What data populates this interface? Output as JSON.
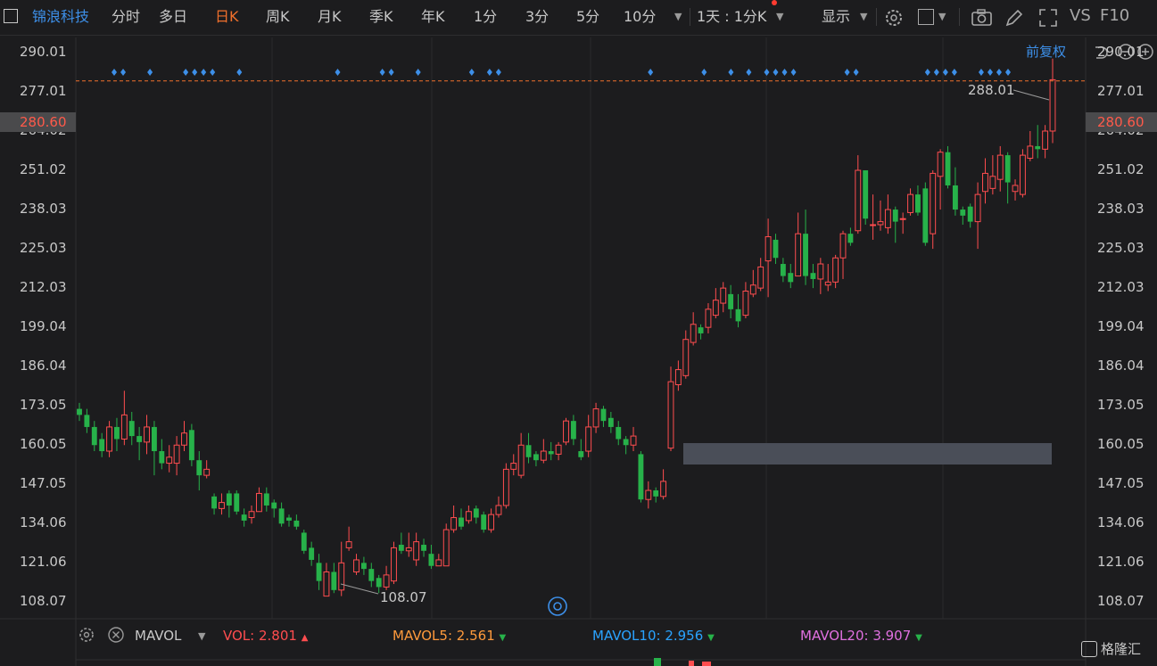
{
  "toolbar": {
    "stock_name": "锦浪科技",
    "periods": [
      "分时",
      "多日",
      "日K",
      "周K",
      "月K",
      "季K",
      "年K",
      "1分",
      "3分",
      "5分",
      "10分"
    ],
    "active_period": "日K",
    "range_label": "1天 : 1分K",
    "display_label": "显示",
    "vs_label": "VS",
    "f10_label": "F10"
  },
  "restore_label": "前复权",
  "price_current": "280.60",
  "high_label": "288.01",
  "low_label": "108.07",
  "chart_data": {
    "type": "candlestick",
    "y_ticks": [
      "290.01",
      "277.01",
      "264.02",
      "251.02",
      "238.03",
      "225.03",
      "212.03",
      "199.04",
      "186.04",
      "173.05",
      "160.05",
      "147.05",
      "134.06",
      "121.06",
      "108.07"
    ],
    "ylim": [
      102.5,
      295
    ],
    "current_price": 280.6,
    "high": 288.01,
    "low": 108.07,
    "candles": [
      [
        172,
        170,
        174,
        168
      ],
      [
        170,
        166,
        172,
        164
      ],
      [
        166,
        160,
        168,
        158
      ],
      [
        162,
        158,
        164,
        156
      ],
      [
        158,
        166,
        168,
        156
      ],
      [
        166,
        162,
        169,
        158
      ],
      [
        162,
        170,
        178,
        160
      ],
      [
        168,
        163,
        171,
        160
      ],
      [
        163,
        161,
        166,
        155
      ],
      [
        161,
        166,
        170,
        157
      ],
      [
        166,
        158,
        168,
        150
      ],
      [
        158,
        154,
        162,
        152
      ],
      [
        154,
        156,
        160,
        151
      ],
      [
        154,
        160,
        163,
        150
      ],
      [
        160,
        164,
        168,
        158
      ],
      [
        165,
        155,
        167,
        153
      ],
      [
        155,
        150,
        158,
        145
      ],
      [
        150,
        152,
        155,
        149
      ],
      [
        143,
        139,
        144,
        137
      ],
      [
        139,
        141,
        144,
        137
      ],
      [
        144,
        140,
        145,
        136
      ],
      [
        144,
        138,
        145,
        137
      ],
      [
        137,
        135,
        139,
        133
      ],
      [
        136,
        138,
        140,
        134
      ],
      [
        138,
        144,
        146,
        138
      ],
      [
        144,
        140,
        146,
        138
      ],
      [
        141,
        139,
        142,
        136
      ],
      [
        139,
        134,
        141,
        133
      ],
      [
        136,
        135,
        137,
        133
      ],
      [
        135,
        133,
        137,
        132
      ],
      [
        131,
        125,
        132,
        124
      ],
      [
        126,
        122,
        128,
        120
      ],
      [
        121,
        115,
        124,
        112
      ],
      [
        110,
        118,
        121,
        110
      ],
      [
        118,
        112,
        121,
        111
      ],
      [
        112,
        121,
        128,
        110
      ],
      [
        126,
        128,
        133,
        125
      ],
      [
        118,
        122,
        124,
        117
      ],
      [
        121,
        119,
        123,
        117
      ],
      [
        119,
        115,
        121,
        113
      ],
      [
        116,
        113,
        117,
        111
      ],
      [
        113,
        117,
        120,
        112
      ],
      [
        115,
        126,
        128,
        114
      ],
      [
        127,
        125,
        131,
        124
      ],
      [
        125,
        126,
        131,
        123
      ],
      [
        122,
        128,
        131,
        120
      ],
      [
        127,
        125,
        129,
        123
      ],
      [
        124,
        120,
        127,
        119
      ],
      [
        120,
        122,
        124,
        120
      ],
      [
        120,
        132,
        134,
        120
      ],
      [
        132,
        136,
        140,
        131
      ],
      [
        136,
        133,
        139,
        132
      ],
      [
        135,
        138,
        140,
        134
      ],
      [
        139,
        136,
        140,
        134
      ],
      [
        137,
        132,
        138,
        131
      ],
      [
        132,
        137,
        139,
        131
      ],
      [
        137,
        140,
        143,
        136
      ],
      [
        140,
        152,
        154,
        139
      ],
      [
        152,
        154,
        157,
        150
      ],
      [
        150,
        160,
        164,
        149
      ],
      [
        160,
        156,
        164,
        154
      ],
      [
        157,
        155,
        158,
        153
      ],
      [
        155,
        158,
        162,
        154
      ],
      [
        158,
        157,
        161,
        155
      ],
      [
        157,
        160,
        161,
        155
      ],
      [
        161,
        168,
        169,
        160
      ],
      [
        168,
        162,
        170,
        160
      ],
      [
        158,
        156,
        162,
        155
      ],
      [
        158,
        166,
        170,
        156
      ],
      [
        166,
        172,
        174,
        164
      ],
      [
        172,
        168,
        173,
        166
      ],
      [
        169,
        166,
        171,
        164
      ],
      [
        166,
        162,
        168,
        160
      ],
      [
        162,
        160,
        163,
        157
      ],
      [
        160,
        163,
        166,
        158
      ],
      [
        157,
        142,
        158,
        141
      ],
      [
        142,
        145,
        148,
        139
      ],
      [
        145,
        143,
        146,
        141
      ],
      [
        143,
        148,
        152,
        142
      ],
      [
        159,
        181,
        186,
        158
      ],
      [
        180,
        185,
        188,
        178
      ],
      [
        183,
        195,
        198,
        182
      ],
      [
        194,
        200,
        204,
        193
      ],
      [
        199,
        197,
        200,
        195
      ],
      [
        199,
        205,
        207,
        197
      ],
      [
        203,
        208,
        212,
        202
      ],
      [
        207,
        212,
        214,
        204
      ],
      [
        210,
        205,
        213,
        202
      ],
      [
        205,
        201,
        210,
        199
      ],
      [
        203,
        211,
        214,
        202
      ],
      [
        210,
        213,
        218,
        209
      ],
      [
        212,
        219,
        222,
        211
      ],
      [
        221,
        229,
        235,
        209
      ],
      [
        228,
        222,
        230,
        220
      ],
      [
        220,
        216,
        222,
        214
      ],
      [
        217,
        214,
        220,
        212
      ],
      [
        216,
        230,
        237,
        216
      ],
      [
        230,
        216,
        238,
        213
      ],
      [
        217,
        215,
        220,
        212
      ],
      [
        215,
        220,
        222,
        210
      ],
      [
        213,
        214,
        220,
        211
      ],
      [
        214,
        222,
        223,
        212
      ],
      [
        222,
        230,
        231,
        215
      ],
      [
        230,
        227,
        232,
        226
      ],
      [
        231,
        251,
        256,
        230
      ],
      [
        251,
        235,
        251,
        233
      ],
      [
        233,
        233,
        243,
        228
      ],
      [
        233,
        234,
        241,
        231
      ],
      [
        232,
        238,
        243,
        230
      ],
      [
        238,
        234,
        239,
        227
      ],
      [
        235,
        235,
        237,
        230
      ],
      [
        237,
        243,
        245,
        236
      ],
      [
        243,
        237,
        246,
        236
      ],
      [
        245,
        227,
        247,
        226
      ],
      [
        230,
        250,
        251,
        225
      ],
      [
        249,
        257,
        258,
        238
      ],
      [
        257,
        246,
        259,
        245
      ],
      [
        246,
        238,
        252,
        236
      ],
      [
        238,
        236,
        239,
        233
      ],
      [
        239,
        234,
        240,
        232
      ],
      [
        234,
        243,
        247,
        225
      ],
      [
        244,
        250,
        255,
        240
      ],
      [
        245,
        249,
        256,
        243
      ],
      [
        248,
        256,
        259,
        244
      ],
      [
        256,
        247,
        257,
        240
      ],
      [
        244,
        246,
        248,
        241
      ],
      [
        243,
        256,
        258,
        242
      ],
      [
        255,
        259,
        264,
        254
      ],
      [
        259,
        258,
        266,
        255
      ],
      [
        258,
        264,
        266,
        255
      ],
      [
        264,
        281,
        288,
        260
      ]
    ],
    "buy_markers": [
      0,
      1,
      4,
      8,
      9,
      10,
      11,
      14,
      25,
      30,
      31,
      34,
      40,
      42,
      43,
      60,
      66,
      69,
      71,
      73,
      74,
      75,
      76,
      82,
      83,
      91,
      92,
      93,
      94,
      97,
      98,
      99,
      100
    ]
  },
  "vol_panel": {
    "indicator": "MAVOL",
    "vol_label": "VOL:",
    "vol_value": "2.801",
    "mavol5_label": "MAVOL5:",
    "mavol5_value": "2.561",
    "mavol10_label": "MAVOL10:",
    "mavol10_value": "2.956",
    "mavol20_label": "MAVOL20:",
    "mavol20_value": "3.907"
  },
  "watermark": "格隆汇",
  "colors": {
    "up": "#ff4d4f",
    "down": "#27b24a",
    "active": "#f0702c",
    "accent_blue": "#3d8fe8",
    "mavol5": "#ff9a3c",
    "mavol10": "#2aa3ff",
    "mavol20": "#e070e0"
  }
}
